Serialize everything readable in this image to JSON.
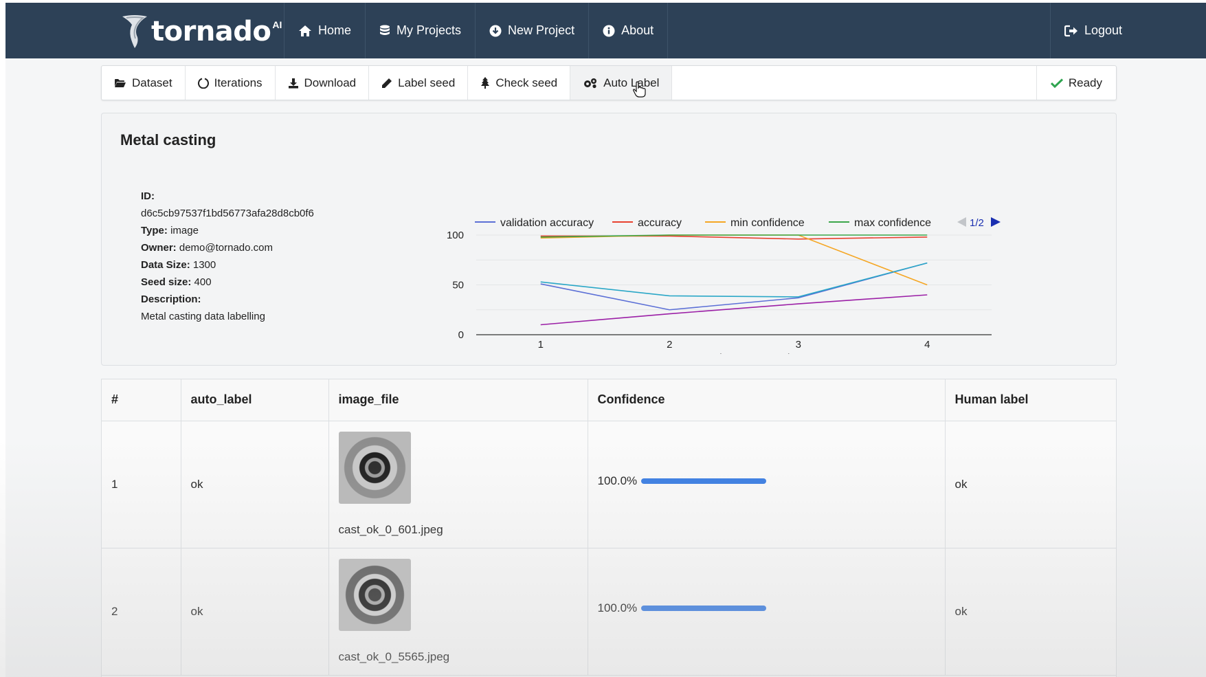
{
  "app": {
    "brand": "tornado",
    "brand_suffix": "AI"
  },
  "nav": {
    "items": [
      {
        "label": "Home",
        "icon": "home-icon"
      },
      {
        "label": "My Projects",
        "icon": "database-icon"
      },
      {
        "label": "New Project",
        "icon": "plus-circle-icon"
      },
      {
        "label": "About",
        "icon": "info-icon"
      }
    ],
    "logout": "Logout"
  },
  "toolbar": {
    "items": [
      {
        "label": "Dataset",
        "icon": "folder-open-icon"
      },
      {
        "label": "Iterations",
        "icon": "circle-notch-icon"
      },
      {
        "label": "Download",
        "icon": "download-icon"
      },
      {
        "label": "Label seed",
        "icon": "pencil-icon"
      },
      {
        "label": "Check seed",
        "icon": "tree-icon"
      },
      {
        "label": "Auto Label",
        "icon": "gears-icon"
      }
    ],
    "active": "Auto Label",
    "status": "Ready"
  },
  "project": {
    "title": "Metal casting",
    "id_label": "ID:",
    "id": "d6c5cb97537f1bd56773afa28d8cb0f6",
    "type_label": "Type:",
    "type": "image",
    "owner_label": "Owner:",
    "owner": "demo@tornado.com",
    "data_size_label": "Data Size:",
    "data_size": "1300",
    "seed_size_label": "Seed size:",
    "seed_size": "400",
    "description_label": "Description:",
    "description": "Metal casting data labelling"
  },
  "chart_data": {
    "type": "line",
    "x": [
      1,
      2,
      3,
      4
    ],
    "xlabel": "Human In The Loop Iterations",
    "ylabel": "",
    "ylim": [
      0,
      100
    ],
    "yticks": [
      0,
      50,
      100
    ],
    "legend_position": "top",
    "legend_pager": "1/2",
    "series": [
      {
        "name": "validation accuracy",
        "color": "#5b6fd6",
        "values": [
          51,
          25,
          37,
          72
        ]
      },
      {
        "name": "accuracy",
        "color": "#e8412f",
        "values": [
          99,
          99,
          96,
          98
        ]
      },
      {
        "name": "min confidence",
        "color": "#f5a623",
        "values": [
          97,
          100,
          100,
          50
        ]
      },
      {
        "name": "max confidence",
        "color": "#3ba64a",
        "values": [
          98,
          100,
          100,
          100
        ]
      },
      {
        "color": "#2aa7c7",
        "values": [
          53,
          39,
          38,
          72
        ]
      },
      {
        "color": "#9b1fa6",
        "values": [
          10,
          21,
          31,
          40
        ]
      }
    ]
  },
  "table": {
    "columns": [
      "#",
      "auto_label",
      "image_file",
      "Confidence",
      "Human label"
    ],
    "rows": [
      {
        "num": "1",
        "auto_label": "ok",
        "image_file": "cast_ok_0_601.jpeg",
        "confidence_text": "100.0%",
        "confidence": 1.0,
        "human_label": "ok"
      },
      {
        "num": "2",
        "auto_label": "ok",
        "image_file": "cast_ok_0_5565.jpeg",
        "confidence_text": "100.0%",
        "confidence": 1.0,
        "human_label": "ok"
      }
    ]
  }
}
